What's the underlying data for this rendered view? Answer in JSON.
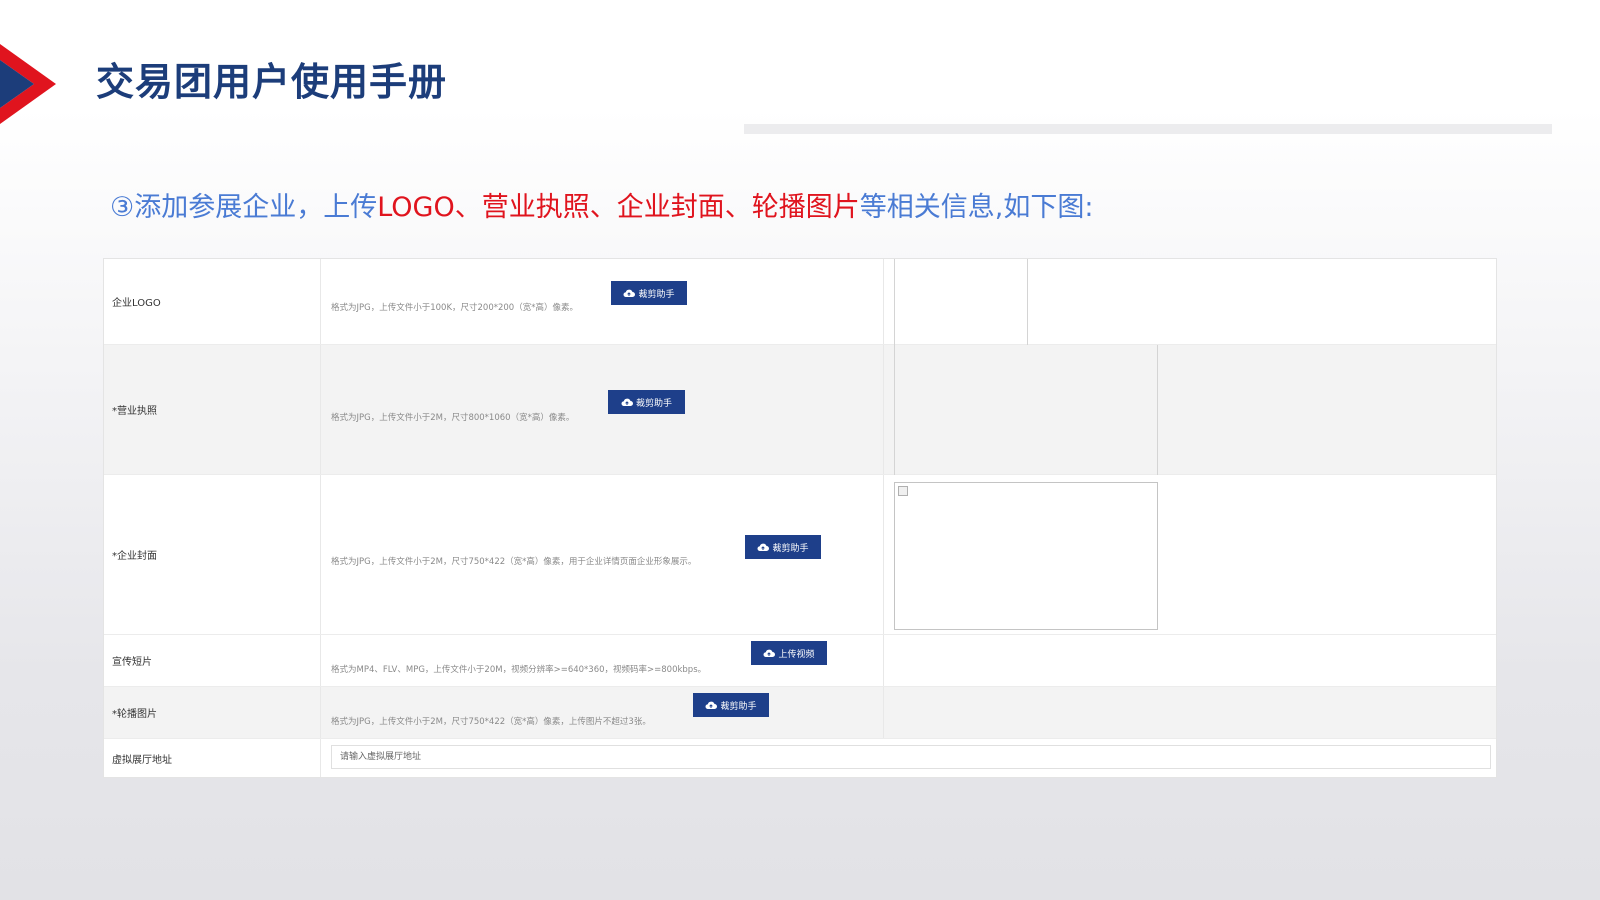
{
  "header": {
    "title": "交易团用户使用手册",
    "brand_colors": [
      "#1c3d7a",
      "#e0141e"
    ]
  },
  "instruction": {
    "prefix": "③添加参展企业，上传",
    "highlight": "LOGO、营业执照、企业封面、轮播图片",
    "suffix": "等相关信息,如下图:"
  },
  "form": {
    "rows": [
      {
        "label": "企业LOGO",
        "hint": "格式为JPG，上传文件小于100K，尺寸200*200（宽*高）像素。",
        "button": "裁剪助手",
        "button_icon": "cloud-upload-icon"
      },
      {
        "label": "*营业执照",
        "hint": "格式为JPG，上传文件小于2M，尺寸800*1060（宽*高）像素。",
        "button": "裁剪助手",
        "button_icon": "cloud-upload-icon"
      },
      {
        "label": "*企业封面",
        "hint": "格式为JPG，上传文件小于2M，尺寸750*422（宽*高）像素，用于企业详情页面企业形象展示。",
        "button": "裁剪助手",
        "button_icon": "cloud-upload-icon"
      },
      {
        "label": "宣传短片",
        "hint": "格式为MP4、FLV、MPG，上传文件小于20M，视频分辨率>=640*360，视频码率>=800kbps。",
        "button": "上传视频",
        "button_icon": "cloud-upload-icon"
      },
      {
        "label": "*轮播图片",
        "hint": "格式为JPG，上传文件小于2M，尺寸750*422（宽*高）像素，上传图片不超过3张。",
        "button": "裁剪助手",
        "button_icon": "cloud-upload-icon"
      },
      {
        "label": "虚拟展厅地址",
        "placeholder": "请输入虚拟展厅地址"
      }
    ]
  }
}
